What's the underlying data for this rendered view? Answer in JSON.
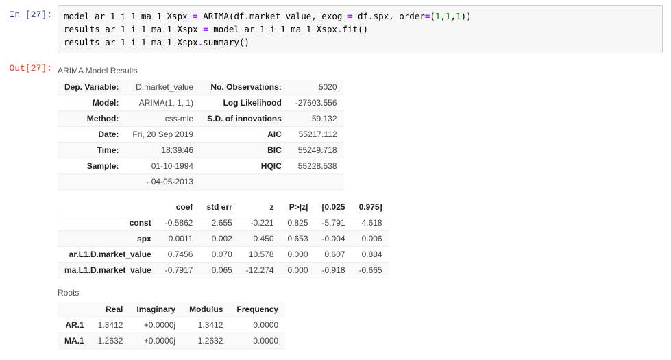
{
  "in_prompt": "In [27]:",
  "out_prompt": "Out[27]:",
  "code": {
    "l1a": "model_ar_1_i_1_ma_1_Xspx ",
    "l1b": "=",
    "l1c": " ARIMA(df",
    "l1d": ".",
    "l1e": "market_value, exog ",
    "l1f": "=",
    "l1g": " df",
    "l1h": ".",
    "l1i": "spx, order",
    "l1j": "=",
    "l1k": "(",
    "l1n1": "1",
    "l1c1": ",",
    "l1n2": "1",
    "l1c2": ",",
    "l1n3": "1",
    "l1end": "))",
    "l2a": "results_ar_1_i_1_ma_1_Xspx ",
    "l2b": "=",
    "l2c": " model_ar_1_i_1_ma_1_Xspx",
    "l2d": ".",
    "l2e": "fit()",
    "l3a": "results_ar_1_i_1_ma_1_Xspx",
    "l3b": ".",
    "l3c": "summary()"
  },
  "title1": "ARIMA Model Results",
  "top": [
    {
      "l": "Dep. Variable:",
      "lv": "D.market_value",
      "r": "No. Observations:",
      "rv": "5020"
    },
    {
      "l": "Model:",
      "lv": "ARIMA(1, 1, 1)",
      "r": "Log Likelihood",
      "rv": "-27603.556"
    },
    {
      "l": "Method:",
      "lv": "css-mle",
      "r": "S.D. of innovations",
      "rv": "59.132"
    },
    {
      "l": "Date:",
      "lv": "Fri, 20 Sep 2019",
      "r": "AIC",
      "rv": "55217.112"
    },
    {
      "l": "Time:",
      "lv": "18:39:46",
      "r": "BIC",
      "rv": "55249.718"
    },
    {
      "l": "Sample:",
      "lv": "01-10-1994",
      "r": "HQIC",
      "rv": "55228.538"
    },
    {
      "l": "",
      "lv": "- 04-05-2013",
      "r": "",
      "rv": ""
    }
  ],
  "coef_hdr": [
    "",
    "coef",
    "std err",
    "z",
    "P>|z|",
    "[0.025",
    "0.975]"
  ],
  "coef": [
    {
      "name": "const",
      "coef": "-0.5862",
      "se": "2.655",
      "z": "-0.221",
      "p": "0.825",
      "lo": "-5.791",
      "hi": "4.618"
    },
    {
      "name": "spx",
      "coef": "0.0011",
      "se": "0.002",
      "z": "0.450",
      "p": "0.653",
      "lo": "-0.004",
      "hi": "0.006"
    },
    {
      "name": "ar.L1.D.market_value",
      "coef": "0.7456",
      "se": "0.070",
      "z": "10.578",
      "p": "0.000",
      "lo": "0.607",
      "hi": "0.884"
    },
    {
      "name": "ma.L1.D.market_value",
      "coef": "-0.7917",
      "se": "0.065",
      "z": "-12.274",
      "p": "0.000",
      "lo": "-0.918",
      "hi": "-0.665"
    }
  ],
  "title2": "Roots",
  "roots_hdr": [
    "",
    "Real",
    "Imaginary",
    "Modulus",
    "Frequency"
  ],
  "roots": [
    {
      "name": "AR.1",
      "real": "1.3412",
      "imag": "+0.0000j",
      "mod": "1.3412",
      "freq": "0.0000"
    },
    {
      "name": "MA.1",
      "real": "1.2632",
      "imag": "+0.0000j",
      "mod": "1.2632",
      "freq": "0.0000"
    }
  ]
}
